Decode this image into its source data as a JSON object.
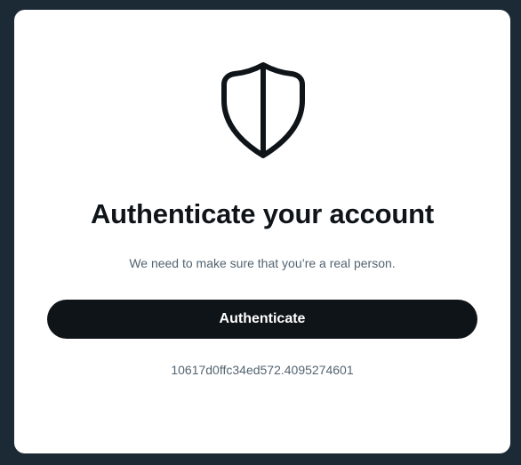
{
  "dialog": {
    "icon": "shield-icon",
    "title": "Authenticate your account",
    "subtitle": "We need to make sure that you’re a real person.",
    "button_label": "Authenticate",
    "token": "10617d0ffc34ed572.4095274601"
  },
  "colors": {
    "background": "#1c2a36",
    "card": "#ffffff",
    "button": "#0f1419",
    "title_text": "#0f1419",
    "secondary_text": "#536471"
  }
}
